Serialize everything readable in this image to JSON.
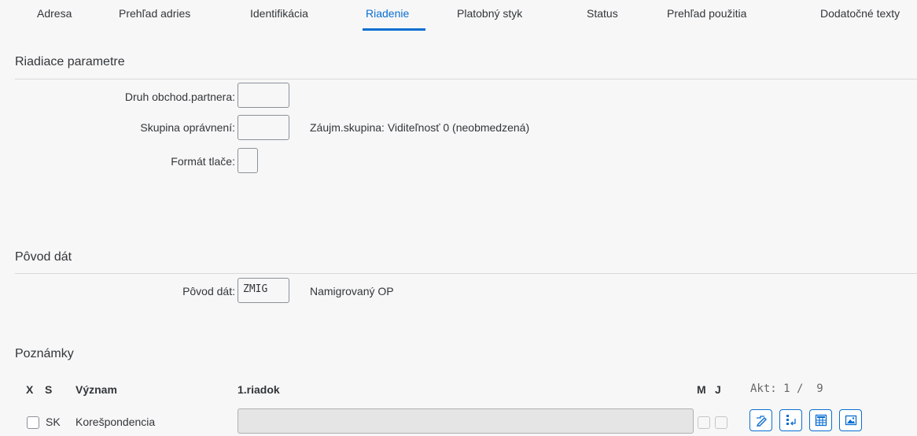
{
  "tabs": [
    {
      "label": "Adresa"
    },
    {
      "label": "Prehľad adries"
    },
    {
      "label": "Identifikácia"
    },
    {
      "label": "Riadenie",
      "active": true
    },
    {
      "label": "Platobný styk"
    },
    {
      "label": "Status"
    },
    {
      "label": "Prehľad použitia"
    },
    {
      "label": "Dodatočné texty"
    }
  ],
  "accent_color": "#0a6ed1",
  "control": {
    "title": "Riadiace parametre",
    "partner_type_label": "Druh obchod.partnera:",
    "partner_type_value": "",
    "auth_group_label": "Skupina oprávnení:",
    "auth_group_value": "",
    "auth_group_info": "Záujm.skupina: Viditeľnosť 0 (neobmedzená)",
    "print_format_label": "Formát tlače:",
    "print_format_value": ""
  },
  "origin": {
    "title": "Pôvod dát",
    "label": "Pôvod dát:",
    "value": "ZMIG",
    "info": "Namigrovaný OP"
  },
  "notes": {
    "title": "Poznámky",
    "headers": {
      "x": "X",
      "s": "S",
      "meaning": "Význam",
      "first_line": "1.riadok",
      "m": "M",
      "j": "J"
    },
    "counter": "Akt: 1 /  9",
    "rows": [
      {
        "checked": false,
        "lang": "SK",
        "meaning": "Korešpondencia",
        "first_line": ""
      }
    ],
    "row_icons": [
      "edit-icon",
      "insert-row-icon",
      "table-icon",
      "image-icon"
    ]
  }
}
